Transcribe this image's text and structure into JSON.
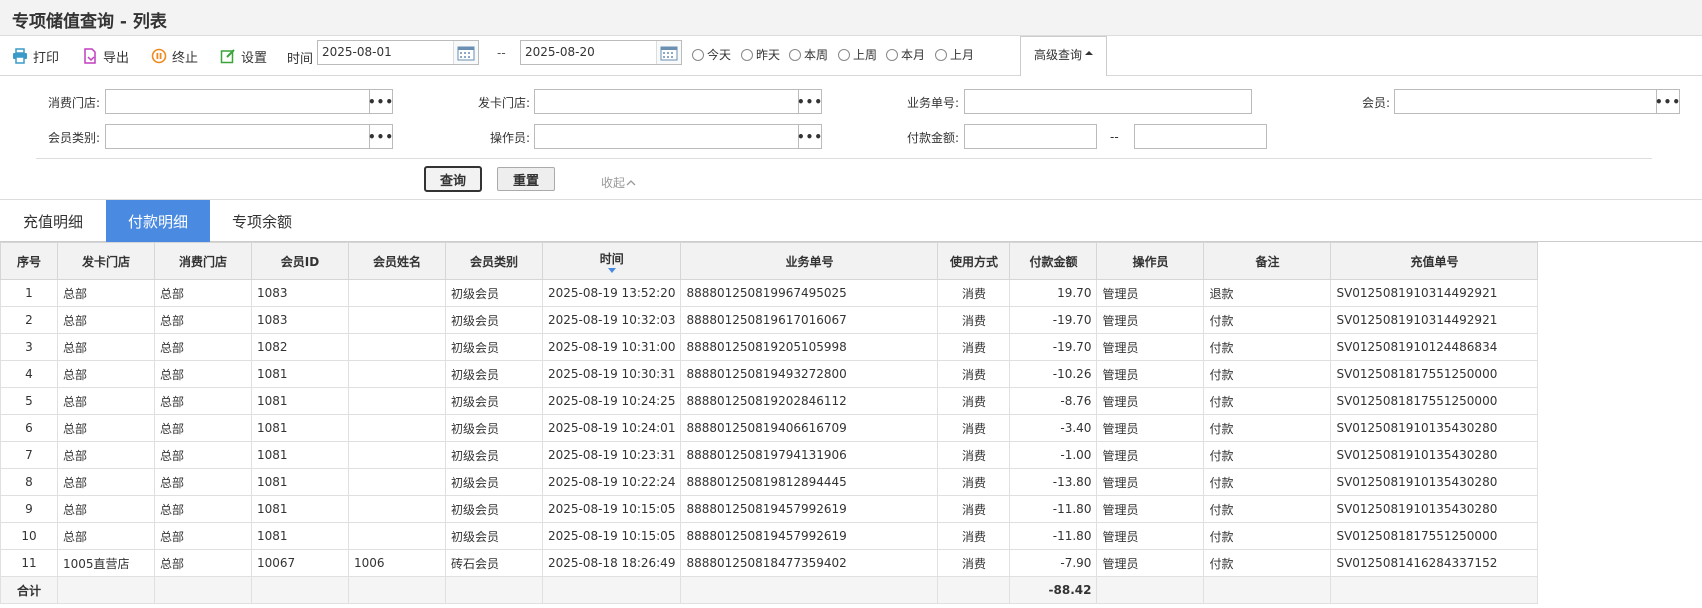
{
  "page": {
    "title": "专项储值查询 - 列表"
  },
  "toolbar": {
    "print": "打印",
    "export": "导出",
    "stop": "终止",
    "settings": "设置",
    "time_label": "时间",
    "date_from": "2025-08-01",
    "date_sep": "--",
    "date_to": "2025-08-20",
    "quick_ranges": [
      "今天",
      "昨天",
      "本周",
      "上周",
      "本月",
      "上月"
    ],
    "advanced": "高级查询"
  },
  "filters": {
    "consume_store": "消费门店:",
    "issue_store": "发卡门店:",
    "business_no": "业务单号:",
    "member": "会员:",
    "member_type": "会员类别:",
    "operator": "操作员:",
    "pay_amount": "付款金额:",
    "amount_sep": "--",
    "dots": "•••",
    "query": "查询",
    "reset": "重置",
    "collapse": "收起"
  },
  "tabs": [
    "充值明细",
    "付款明细",
    "专项余额"
  ],
  "active_tab": 1,
  "colors": {
    "accent": "#4a8ae0",
    "print_icon": "#3b9bc8",
    "export_icon": "#c03fc0",
    "stop_icon": "#f08a1e",
    "settings_icon": "#3aa33a"
  },
  "table": {
    "headers": [
      "序号",
      "发卡门店",
      "消费门店",
      "会员ID",
      "会员姓名",
      "会员类别",
      "时间",
      "业务单号",
      "使用方式",
      "付款金额",
      "操作员",
      "备注",
      "充值单号"
    ],
    "rows": [
      [
        "1",
        "总部",
        "总部",
        "1083",
        "",
        "初级会员",
        "2025-08-19 13:52:20",
        "888801250819967495025",
        "消费",
        "19.70",
        "管理员",
        "退款",
        "SV0125081910314492921"
      ],
      [
        "2",
        "总部",
        "总部",
        "1083",
        "",
        "初级会员",
        "2025-08-19 10:32:03",
        "888801250819617016067",
        "消费",
        "-19.70",
        "管理员",
        "付款",
        "SV0125081910314492921"
      ],
      [
        "3",
        "总部",
        "总部",
        "1082",
        "",
        "初级会员",
        "2025-08-19 10:31:00",
        "888801250819205105998",
        "消费",
        "-19.70",
        "管理员",
        "付款",
        "SV0125081910124486834"
      ],
      [
        "4",
        "总部",
        "总部",
        "1081",
        "",
        "初级会员",
        "2025-08-19 10:30:31",
        "888801250819493272800",
        "消费",
        "-10.26",
        "管理员",
        "付款",
        "SV0125081817551250000"
      ],
      [
        "5",
        "总部",
        "总部",
        "1081",
        "",
        "初级会员",
        "2025-08-19 10:24:25",
        "888801250819202846112",
        "消费",
        "-8.76",
        "管理员",
        "付款",
        "SV0125081817551250000"
      ],
      [
        "6",
        "总部",
        "总部",
        "1081",
        "",
        "初级会员",
        "2025-08-19 10:24:01",
        "888801250819406616709",
        "消费",
        "-3.40",
        "管理员",
        "付款",
        "SV0125081910135430280"
      ],
      [
        "7",
        "总部",
        "总部",
        "1081",
        "",
        "初级会员",
        "2025-08-19 10:23:31",
        "888801250819794131906",
        "消费",
        "-1.00",
        "管理员",
        "付款",
        "SV0125081910135430280"
      ],
      [
        "8",
        "总部",
        "总部",
        "1081",
        "",
        "初级会员",
        "2025-08-19 10:22:24",
        "888801250819812894445",
        "消费",
        "-13.80",
        "管理员",
        "付款",
        "SV0125081910135430280"
      ],
      [
        "9",
        "总部",
        "总部",
        "1081",
        "",
        "初级会员",
        "2025-08-19 10:15:05",
        "888801250819457992619",
        "消费",
        "-11.80",
        "管理员",
        "付款",
        "SV0125081910135430280"
      ],
      [
        "10",
        "总部",
        "总部",
        "1081",
        "",
        "初级会员",
        "2025-08-19 10:15:05",
        "888801250819457992619",
        "消费",
        "-11.80",
        "管理员",
        "付款",
        "SV0125081817551250000"
      ],
      [
        "11",
        "1005直营店",
        "总部",
        "10067",
        "1006",
        "砖石会员",
        "2025-08-18 18:26:49",
        "888801250818477359402",
        "消费",
        "-7.90",
        "管理员",
        "付款",
        "SV0125081416284337152"
      ]
    ],
    "total_label": "合计",
    "total_amount": "-88.42"
  }
}
